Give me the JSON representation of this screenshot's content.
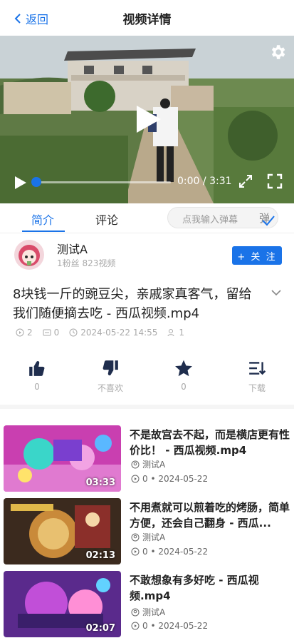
{
  "header": {
    "back_label": "返回",
    "title": "视频详情"
  },
  "player": {
    "current_time": "0:00",
    "duration": "3:31",
    "progress": 0.0
  },
  "tabs": [
    {
      "label": "简介",
      "active": true
    },
    {
      "label": "评论",
      "active": false
    }
  ],
  "danmu": {
    "placeholder": "点我输入弹幕",
    "button_label": "弹"
  },
  "author": {
    "name": "测试A",
    "meta": "1粉丝 823视频",
    "follow_label": "+ 关 注"
  },
  "video": {
    "title": "8块钱一斤的豌豆尖，亲戚家真客气，留给我们随便摘去吃 - 西瓜视频.mp4",
    "plays": "2",
    "danmaku": "0",
    "date": "2024-05-22 14:55",
    "viewers": "1"
  },
  "actions": [
    {
      "icon": "thumb-up-icon",
      "label": "0"
    },
    {
      "icon": "thumb-down-icon",
      "label": "不喜欢"
    },
    {
      "icon": "star-icon",
      "label": "0"
    },
    {
      "icon": "download-icon",
      "label": "下载"
    }
  ],
  "related": [
    {
      "title": "不是故宫去不起，而是横店更有性价比！ - 西瓜视频.mp4",
      "author": "测试A",
      "meta": "0 • 2024-05-22",
      "duration": "03:33"
    },
    {
      "title": "不用煮就可以煎着吃的烤肠，简单方便，还会自己翻身 - 西瓜...",
      "author": "测试A",
      "meta": "0 • 2024-05-22",
      "duration": "02:13"
    },
    {
      "title": "不敢想象有多好吃 - 西瓜视频.mp4",
      "author": "测试A",
      "meta": "0 • 2024-05-22",
      "duration": "02:07"
    }
  ],
  "colors": {
    "accent": "#1a73e8"
  }
}
